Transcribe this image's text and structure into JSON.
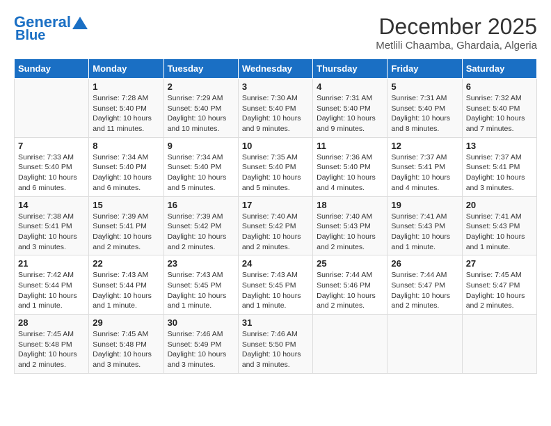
{
  "logo": {
    "line1": "General",
    "line2": "Blue"
  },
  "title": "December 2025",
  "location": "Metlili Chaamba, Ghardaia, Algeria",
  "weekdays": [
    "Sunday",
    "Monday",
    "Tuesday",
    "Wednesday",
    "Thursday",
    "Friday",
    "Saturday"
  ],
  "weeks": [
    [
      {
        "day": "",
        "info": ""
      },
      {
        "day": "1",
        "info": "Sunrise: 7:28 AM\nSunset: 5:40 PM\nDaylight: 10 hours\nand 11 minutes."
      },
      {
        "day": "2",
        "info": "Sunrise: 7:29 AM\nSunset: 5:40 PM\nDaylight: 10 hours\nand 10 minutes."
      },
      {
        "day": "3",
        "info": "Sunrise: 7:30 AM\nSunset: 5:40 PM\nDaylight: 10 hours\nand 9 minutes."
      },
      {
        "day": "4",
        "info": "Sunrise: 7:31 AM\nSunset: 5:40 PM\nDaylight: 10 hours\nand 9 minutes."
      },
      {
        "day": "5",
        "info": "Sunrise: 7:31 AM\nSunset: 5:40 PM\nDaylight: 10 hours\nand 8 minutes."
      },
      {
        "day": "6",
        "info": "Sunrise: 7:32 AM\nSunset: 5:40 PM\nDaylight: 10 hours\nand 7 minutes."
      }
    ],
    [
      {
        "day": "7",
        "info": "Sunrise: 7:33 AM\nSunset: 5:40 PM\nDaylight: 10 hours\nand 6 minutes."
      },
      {
        "day": "8",
        "info": "Sunrise: 7:34 AM\nSunset: 5:40 PM\nDaylight: 10 hours\nand 6 minutes."
      },
      {
        "day": "9",
        "info": "Sunrise: 7:34 AM\nSunset: 5:40 PM\nDaylight: 10 hours\nand 5 minutes."
      },
      {
        "day": "10",
        "info": "Sunrise: 7:35 AM\nSunset: 5:40 PM\nDaylight: 10 hours\nand 5 minutes."
      },
      {
        "day": "11",
        "info": "Sunrise: 7:36 AM\nSunset: 5:40 PM\nDaylight: 10 hours\nand 4 minutes."
      },
      {
        "day": "12",
        "info": "Sunrise: 7:37 AM\nSunset: 5:41 PM\nDaylight: 10 hours\nand 4 minutes."
      },
      {
        "day": "13",
        "info": "Sunrise: 7:37 AM\nSunset: 5:41 PM\nDaylight: 10 hours\nand 3 minutes."
      }
    ],
    [
      {
        "day": "14",
        "info": "Sunrise: 7:38 AM\nSunset: 5:41 PM\nDaylight: 10 hours\nand 3 minutes."
      },
      {
        "day": "15",
        "info": "Sunrise: 7:39 AM\nSunset: 5:41 PM\nDaylight: 10 hours\nand 2 minutes."
      },
      {
        "day": "16",
        "info": "Sunrise: 7:39 AM\nSunset: 5:42 PM\nDaylight: 10 hours\nand 2 minutes."
      },
      {
        "day": "17",
        "info": "Sunrise: 7:40 AM\nSunset: 5:42 PM\nDaylight: 10 hours\nand 2 minutes."
      },
      {
        "day": "18",
        "info": "Sunrise: 7:40 AM\nSunset: 5:43 PM\nDaylight: 10 hours\nand 2 minutes."
      },
      {
        "day": "19",
        "info": "Sunrise: 7:41 AM\nSunset: 5:43 PM\nDaylight: 10 hours\nand 1 minute."
      },
      {
        "day": "20",
        "info": "Sunrise: 7:41 AM\nSunset: 5:43 PM\nDaylight: 10 hours\nand 1 minute."
      }
    ],
    [
      {
        "day": "21",
        "info": "Sunrise: 7:42 AM\nSunset: 5:44 PM\nDaylight: 10 hours\nand 1 minute."
      },
      {
        "day": "22",
        "info": "Sunrise: 7:43 AM\nSunset: 5:44 PM\nDaylight: 10 hours\nand 1 minute."
      },
      {
        "day": "23",
        "info": "Sunrise: 7:43 AM\nSunset: 5:45 PM\nDaylight: 10 hours\nand 1 minute."
      },
      {
        "day": "24",
        "info": "Sunrise: 7:43 AM\nSunset: 5:45 PM\nDaylight: 10 hours\nand 1 minute."
      },
      {
        "day": "25",
        "info": "Sunrise: 7:44 AM\nSunset: 5:46 PM\nDaylight: 10 hours\nand 2 minutes."
      },
      {
        "day": "26",
        "info": "Sunrise: 7:44 AM\nSunset: 5:47 PM\nDaylight: 10 hours\nand 2 minutes."
      },
      {
        "day": "27",
        "info": "Sunrise: 7:45 AM\nSunset: 5:47 PM\nDaylight: 10 hours\nand 2 minutes."
      }
    ],
    [
      {
        "day": "28",
        "info": "Sunrise: 7:45 AM\nSunset: 5:48 PM\nDaylight: 10 hours\nand 2 minutes."
      },
      {
        "day": "29",
        "info": "Sunrise: 7:45 AM\nSunset: 5:48 PM\nDaylight: 10 hours\nand 3 minutes."
      },
      {
        "day": "30",
        "info": "Sunrise: 7:46 AM\nSunset: 5:49 PM\nDaylight: 10 hours\nand 3 minutes."
      },
      {
        "day": "31",
        "info": "Sunrise: 7:46 AM\nSunset: 5:50 PM\nDaylight: 10 hours\nand 3 minutes."
      },
      {
        "day": "",
        "info": ""
      },
      {
        "day": "",
        "info": ""
      },
      {
        "day": "",
        "info": ""
      }
    ]
  ]
}
